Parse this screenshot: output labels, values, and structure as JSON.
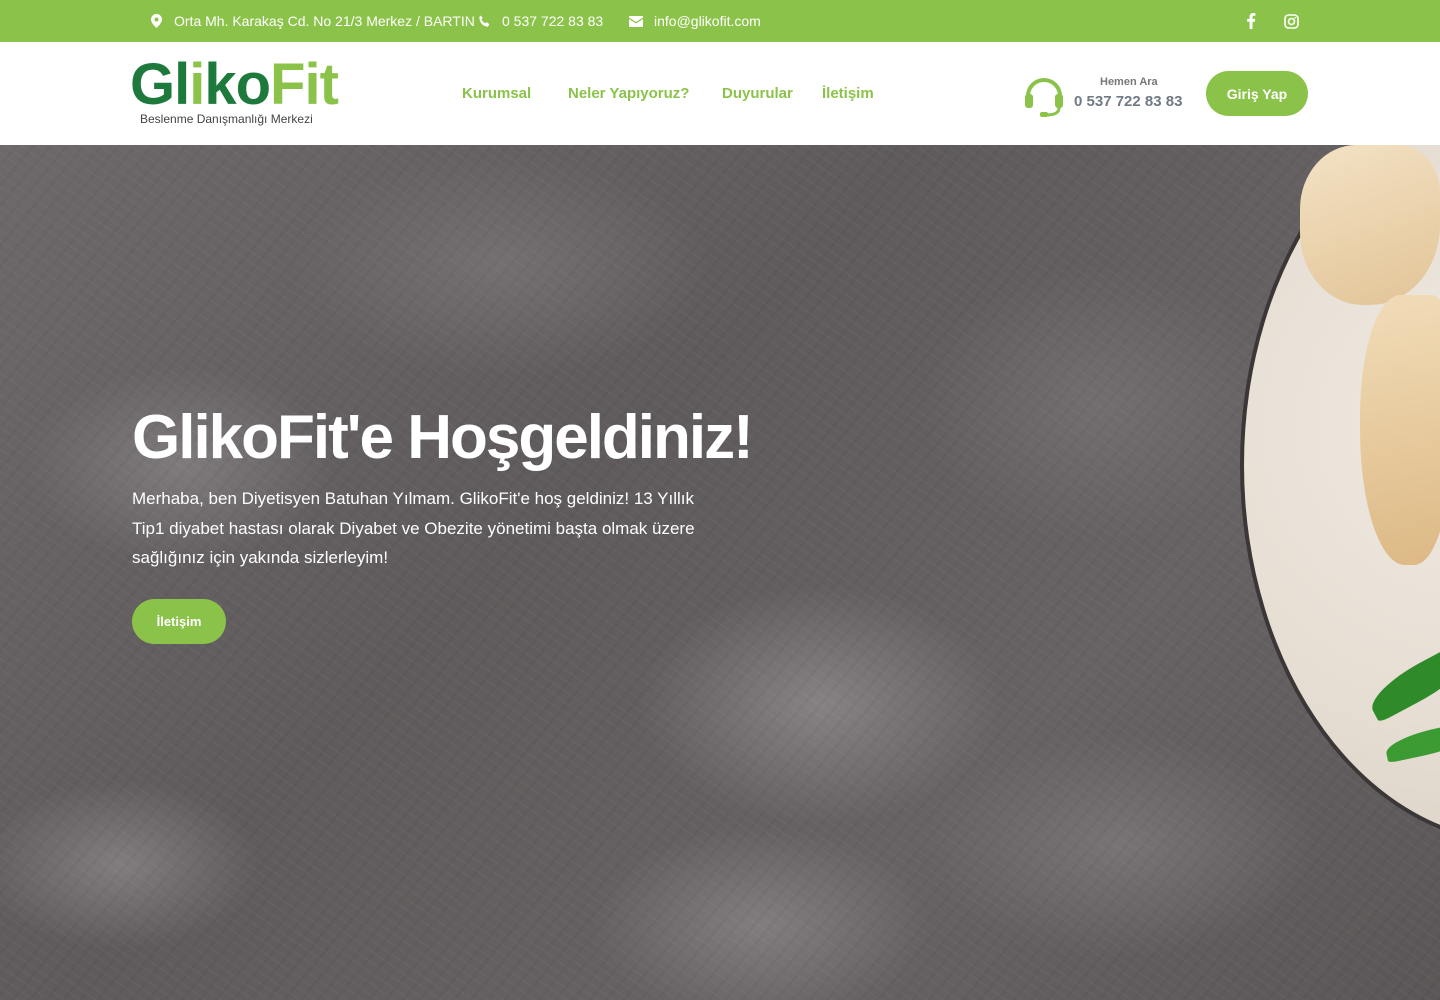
{
  "colors": {
    "accent": "#8bc34a",
    "logo_dark": "#1e7a3c",
    "text_light": "#ffffff"
  },
  "topbar": {
    "address": "Orta Mh. Karakaş Cd. No 21/3 Merkez / BARTIN",
    "address_icon": "map-marker-icon",
    "phone": "0 537 722 83 83",
    "phone_icon": "phone-icon",
    "email": "info@glikofit.com",
    "email_icon": "envelope-icon",
    "social": [
      {
        "icon": "facebook-icon"
      },
      {
        "icon": "instagram-icon"
      }
    ]
  },
  "header": {
    "logo": {
      "word_a": "Gl",
      "word_i": "i",
      "word_b": "ko",
      "word_c": "Fit",
      "tagline": "Beslenme Danışmanlığı Merkezi"
    },
    "nav": [
      {
        "label": "Kurumsal"
      },
      {
        "label": "Neler Yapıyoruz?"
      },
      {
        "label": "Duyurular"
      },
      {
        "label": "İletişim"
      }
    ],
    "call": {
      "label": "Hemen Ara",
      "number": "0 537 722 83 83",
      "icon": "headset-icon"
    },
    "login_label": "Giriş Yap"
  },
  "hero": {
    "title": "GlikoFit'e Hoşgeldiniz!",
    "text": "Merhaba, ben Diyetisyen Batuhan Yılmam. GlikoFit'e hoş geldiniz! 13 Yıllık Tip1 diyabet hastası olarak Diyabet ve Obezite yönetimi başta olmak üzere sağlığınız için yakında sizlerleyim!",
    "button_label": "İletişim"
  }
}
